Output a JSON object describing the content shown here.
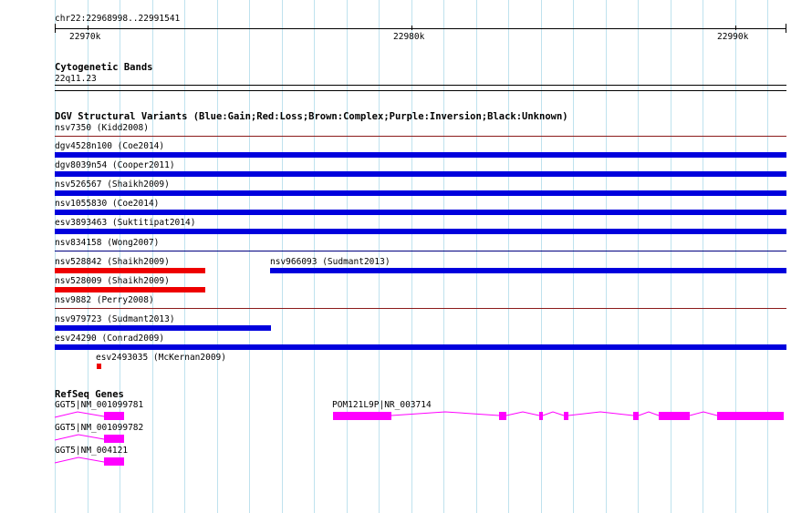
{
  "colors": {
    "gain": "#0000dd",
    "loss": "#ee0000",
    "complex": "#8b1a1a",
    "inversion": "#800080",
    "unknown": "#000000",
    "gene": "#ff00ff",
    "grid": "#bfe2ee"
  },
  "ruler": {
    "location": "chr22:22968998..22991541",
    "ticks": [
      "22970k",
      "22980k",
      "22990k"
    ]
  },
  "cytoband": {
    "title": "Cytogenetic Bands",
    "band": "22q11.23"
  },
  "dgv": {
    "title": "DGV Structural Variants (Blue:Gain;Red:Loss;Brown:Complex;Purple:Inversion;Black:Unknown)",
    "variants": [
      {
        "label": "nsv7350 (Kidd2008)",
        "type": "complex"
      },
      {
        "label": "dgv4528n100 (Coe2014)",
        "type": "gain"
      },
      {
        "label": "dgv8039n54 (Cooper2011)",
        "type": "gain"
      },
      {
        "label": "nsv526567 (Shaikh2009)",
        "type": "gain"
      },
      {
        "label": "nsv1055830 (Coe2014)",
        "type": "gain"
      },
      {
        "label": "esv3893463 (Suktitipat2014)",
        "type": "gain"
      },
      {
        "label": "nsv834158 (Wong2007)",
        "type": "inversion"
      },
      {
        "label": "nsv528842 (Shaikh2009)",
        "type": "loss"
      },
      {
        "label": "nsv966093 (Sudmant2013)",
        "type": "gain"
      },
      {
        "label": "nsv528009 (Shaikh2009)",
        "type": "loss"
      },
      {
        "label": "nsv9882 (Perry2008)",
        "type": "complex"
      },
      {
        "label": "nsv979723 (Sudmant2013)",
        "type": "gain"
      },
      {
        "label": "esv24290 (Conrad2009)",
        "type": "gain"
      },
      {
        "label": "esv2493035 (McKernan2009)",
        "type": "loss"
      }
    ]
  },
  "refseq": {
    "title": "RefSeq Genes",
    "genes": [
      {
        "label": "GGT5|NM_001099781"
      },
      {
        "label": "POM121L9P|NR_003714"
      },
      {
        "label": "GGT5|NM_001099782"
      },
      {
        "label": "GGT5|NM_004121"
      }
    ]
  }
}
